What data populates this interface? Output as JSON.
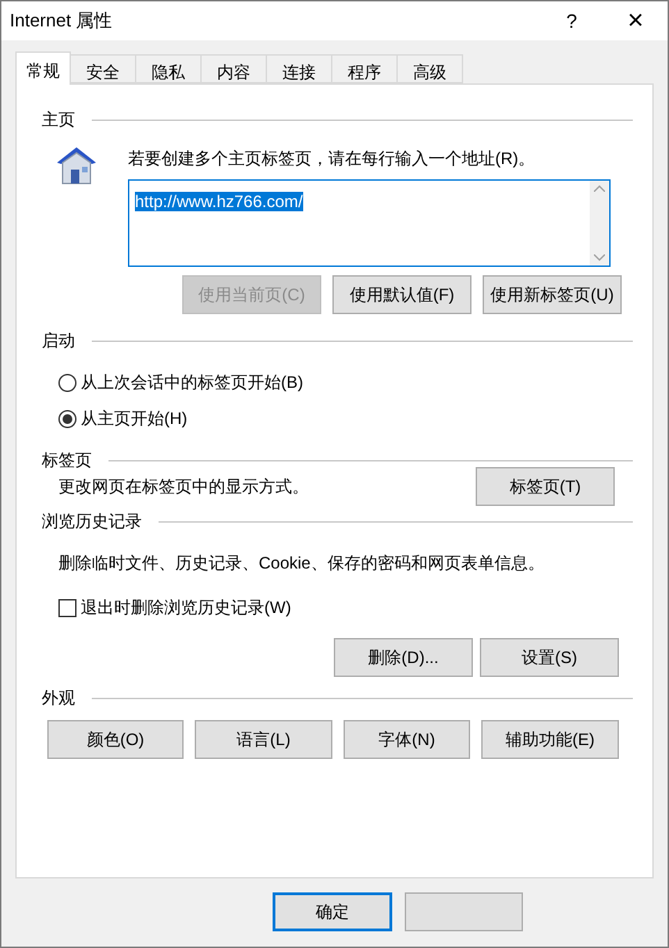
{
  "window": {
    "title": "Internet 属性",
    "help": "?",
    "close": "×"
  },
  "tabs": [
    {
      "label": "常规",
      "selected": true
    },
    {
      "label": "安全",
      "selected": false
    },
    {
      "label": "隐私",
      "selected": false
    },
    {
      "label": "内容",
      "selected": false
    },
    {
      "label": "连接",
      "selected": false
    },
    {
      "label": "程序",
      "selected": false
    },
    {
      "label": "高级",
      "selected": false
    }
  ],
  "home": {
    "heading": "主页",
    "instruction": "若要创建多个主页标签页，请在每行输入一个地址(R)。",
    "value": "http://www.hz766.com/",
    "buttons": [
      {
        "label": "使用当前页(C)",
        "disabled": true
      },
      {
        "label": "使用默认值(F)",
        "disabled": false
      },
      {
        "label": "使用新标签页(U)",
        "disabled": false
      }
    ]
  },
  "startup": {
    "heading": "启动",
    "options": [
      {
        "label": "从上次会话中的标签页开始(B)",
        "selected": false
      },
      {
        "label": "从主页开始(H)",
        "selected": true
      }
    ]
  },
  "tabs_section": {
    "heading": "标签页",
    "description": "更改网页在标签页中的显示方式。",
    "button": "标签页(T)"
  },
  "history": {
    "heading": "浏览历史记录",
    "description": "删除临时文件、历史记录、Cookie、保存的密码和网页表单信息。",
    "checkbox": {
      "label": "退出时删除浏览历史记录(W)",
      "checked": false
    },
    "buttons": [
      "删除(D)...",
      "设置(S)"
    ]
  },
  "appearance": {
    "heading": "外观",
    "buttons": [
      "颜色(O)",
      "语言(L)",
      "字体(N)",
      "辅助功能(E)"
    ]
  },
  "footer": {
    "buttons": [
      {
        "label": "确定",
        "default": true
      }
    ]
  }
}
